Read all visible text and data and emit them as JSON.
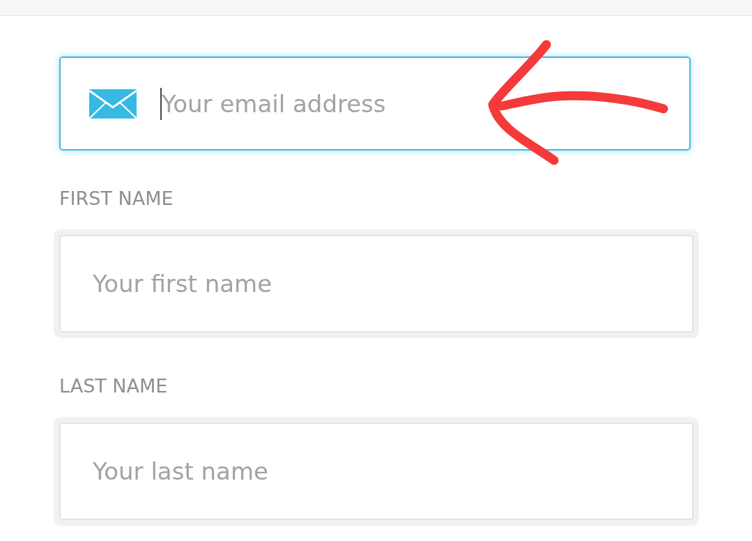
{
  "email_field": {
    "placeholder": "Your email address",
    "focused": true
  },
  "fields": [
    {
      "label": "FIRST NAME",
      "placeholder": "Your first name",
      "focused": false
    },
    {
      "label": "LAST NAME",
      "placeholder": "Your last name",
      "focused": false
    }
  ],
  "annotations": [
    {
      "kind": "arrow",
      "color": "#f43a3a"
    }
  ]
}
